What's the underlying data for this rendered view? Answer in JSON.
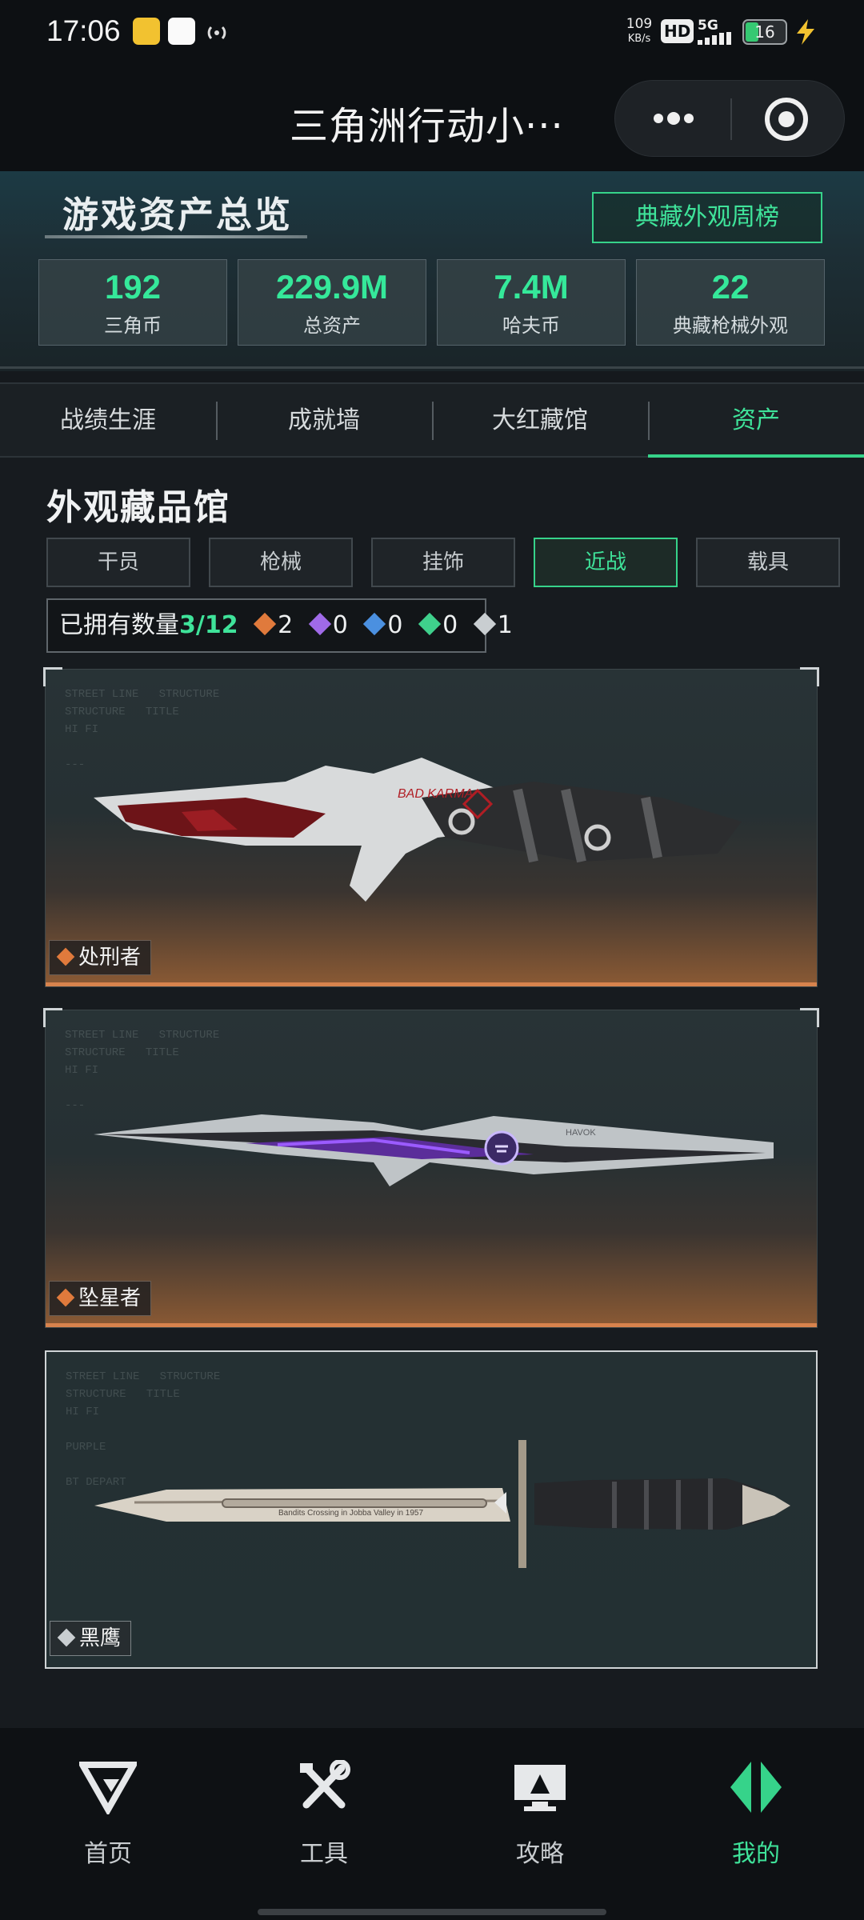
{
  "status_bar": {
    "time": "17:06",
    "speed_value": "109",
    "speed_unit": "KB/s",
    "hd": "HD",
    "network": "5G",
    "battery": "16"
  },
  "titlebar": {
    "title": "三角洲行动小···"
  },
  "hero": {
    "title": "游戏资产总览",
    "weekly_button": "典藏外观周榜",
    "stats": [
      {
        "value": "192",
        "label": "三角币"
      },
      {
        "value": "229.9M",
        "label": "总资产"
      },
      {
        "value": "7.4M",
        "label": "哈夫币"
      },
      {
        "value": "22",
        "label": "典藏枪械外观"
      }
    ]
  },
  "tabs": [
    {
      "label": "战绩生涯"
    },
    {
      "label": "成就墙"
    },
    {
      "label": "大红藏馆"
    },
    {
      "label": "资产"
    }
  ],
  "collection": {
    "title": "外观藏品馆",
    "filters": [
      {
        "label": "干员"
      },
      {
        "label": "枪械"
      },
      {
        "label": "挂饰"
      },
      {
        "label": "近战"
      },
      {
        "label": "载具"
      }
    ],
    "owned_label": "已拥有数量",
    "owned_count": "3/12",
    "rarity_counts": [
      {
        "value": "2",
        "color": "#e07a3c"
      },
      {
        "value": "0",
        "color": "#a06ae8"
      },
      {
        "value": "0",
        "color": "#4b90e0"
      },
      {
        "value": "0",
        "color": "#3fd08c"
      },
      {
        "value": "1",
        "color": "#c9ced1"
      }
    ],
    "items": [
      {
        "name": "处刑者",
        "rarity_color": "#e07a3c",
        "blade_text": "BAD KARMA"
      },
      {
        "name": "坠星者",
        "rarity_color": "#e07a3c",
        "blade_text": "HAVOK"
      },
      {
        "name": "黑鹰",
        "rarity_color": "#c9ced1",
        "blade_text": "Bandits Crossing in Jobba Valley in 1957"
      }
    ]
  },
  "nav": [
    {
      "label": "首页",
      "icon": "delta-logo-icon"
    },
    {
      "label": "工具",
      "icon": "tools-icon"
    },
    {
      "label": "攻略",
      "icon": "monitor-guide-icon"
    },
    {
      "label": "我的",
      "icon": "profile-logo-icon"
    }
  ]
}
